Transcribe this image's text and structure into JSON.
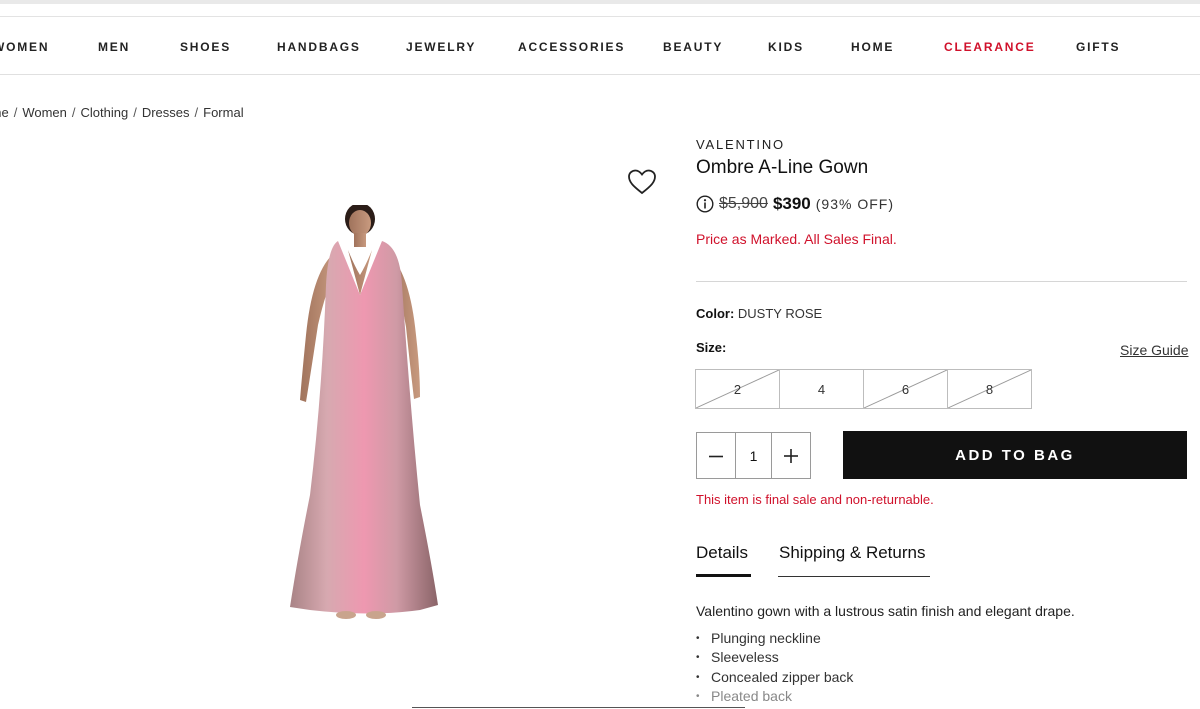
{
  "nav": {
    "items": [
      "WOMEN",
      "MEN",
      "SHOES",
      "HANDBAGS",
      "JEWELRY",
      "ACCESSORIES",
      "BEAUTY",
      "KIDS",
      "HOME",
      "CLEARANCE",
      "GIFTS"
    ]
  },
  "breadcrumb": [
    "Home",
    "Women",
    "Clothing",
    "Dresses",
    "Formal"
  ],
  "product": {
    "brand": "VALENTINO",
    "title": "Ombre A-Line Gown",
    "original_price": "$5,900",
    "sale_price": "$390",
    "percent_off": "(93% OFF)",
    "price_note": "Price as Marked. All Sales Final.",
    "color_label": "Color:",
    "color_value": "DUSTY ROSE",
    "size_label": "Size:",
    "size_guide": "Size Guide",
    "sizes": [
      {
        "label": "2",
        "available": false
      },
      {
        "label": "4",
        "available": true
      },
      {
        "label": "6",
        "available": false
      },
      {
        "label": "8",
        "available": false
      }
    ],
    "quantity": "1",
    "add_to_bag": "ADD TO BAG",
    "final_sale_note": "This item is final sale and non-returnable."
  },
  "tabs": {
    "details": "Details",
    "shipping": "Shipping & Returns",
    "active": "details"
  },
  "details": {
    "description": "Valentino gown with a lustrous satin finish and elegant drape.",
    "bullets": [
      "Plunging neckline",
      "Sleeveless",
      "Concealed zipper back",
      "Pleated back"
    ]
  },
  "colors": {
    "sale_red": "#d0112b",
    "button_black": "#111111",
    "gown_pink": "#e8a3b4"
  },
  "icons": {
    "wishlist": "heart-outline-icon",
    "price_info": "info-circle-icon",
    "qty_minus": "minus-icon",
    "qty_plus": "plus-icon"
  }
}
